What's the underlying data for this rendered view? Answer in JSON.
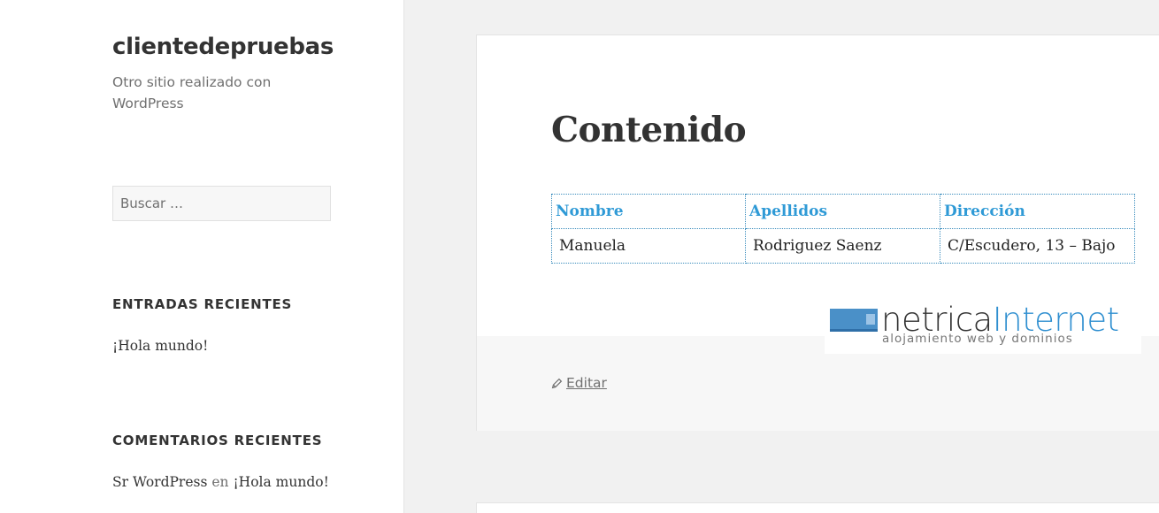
{
  "site": {
    "title": "clientedepruebas",
    "description": "Otro sitio realizado con WordPress"
  },
  "search": {
    "placeholder": "Buscar …"
  },
  "widgets": {
    "recent_posts": {
      "title": "ENTRADAS RECIENTES",
      "items": [
        "¡Hola mundo!"
      ]
    },
    "recent_comments": {
      "title": "COMENTARIOS RECIENTES",
      "author": "Sr WordPress",
      "connector": "en",
      "post": "¡Hola mundo!"
    }
  },
  "post": {
    "title": "Contenido",
    "table": {
      "headers": [
        "Nombre",
        "Apellidos",
        "Dirección"
      ],
      "rows": [
        [
          "Manuela",
          "Rodriguez Saenz",
          "C/Escudero, 13 – Bajo"
        ]
      ]
    },
    "edit_label": "Editar"
  },
  "banner": {
    "brand_dark": "netrica",
    "brand_blue": "Internet",
    "tagline": "alojamiento web y dominios"
  },
  "colors": {
    "link_blue": "#2f9ad6",
    "background": "#f1f1f1",
    "sidebar": "#ffffff"
  }
}
